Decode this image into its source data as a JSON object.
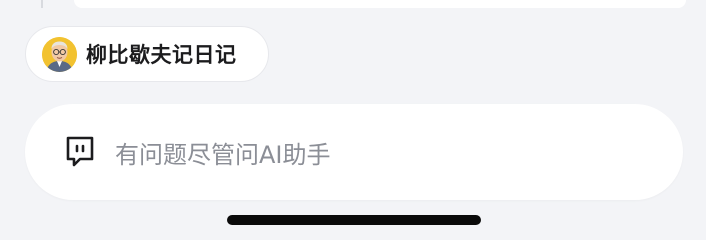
{
  "chip": {
    "label": "柳比歇夫记日记",
    "avatar_icon": "cartoon-portrait-avatar"
  },
  "input_bar": {
    "icon": "chat-bubble-icon",
    "placeholder": "有问题尽管问AI助手"
  },
  "colors": {
    "background": "#f3f4f7",
    "surface": "#ffffff",
    "placeholder": "#8b8e96",
    "text": "#1c1c1e",
    "avatar_bg": "#f2c230",
    "home_indicator": "#0a0a0a"
  }
}
